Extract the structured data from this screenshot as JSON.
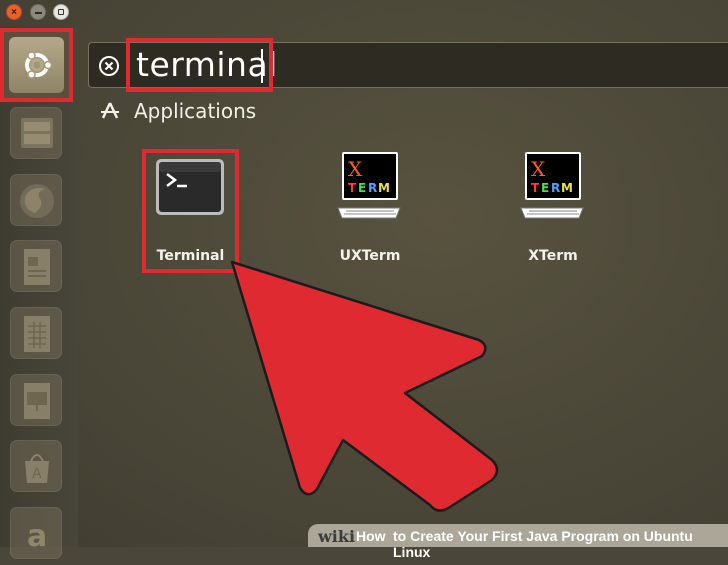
{
  "search": {
    "query": "terminal"
  },
  "category": {
    "label": "Applications"
  },
  "apps": [
    {
      "label": "Terminal",
      "icon": "terminal-icon"
    },
    {
      "label": "UXTerm",
      "icon": "uxterm-icon"
    },
    {
      "label": "XTerm",
      "icon": "xterm-icon"
    }
  ],
  "xterm_icon_text": {
    "x": "X",
    "term": "TERM"
  },
  "footer": {
    "wiki": "wiki",
    "how": "How",
    "title": "to Create Your First Java Program on Ubuntu Linux"
  },
  "colors": {
    "highlight": "#e02a32",
    "arrow": "#e02a32",
    "background": "#4a4639"
  },
  "launcher_icons": [
    "ubuntu-logo-icon",
    "files-icon",
    "firefox-icon",
    "writer-icon",
    "calc-icon",
    "impress-icon",
    "software-center-icon",
    "amazon-icon"
  ]
}
